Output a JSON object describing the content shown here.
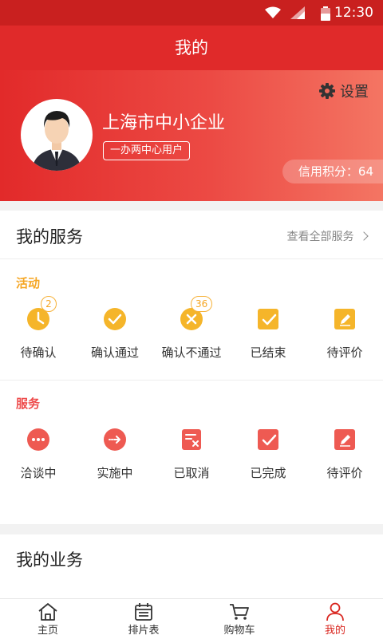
{
  "status_bar": {
    "time": "12:30"
  },
  "header": {
    "title": "我的"
  },
  "profile": {
    "company": "上海市中小企业",
    "user_tag": "一办两中心用户",
    "settings_label": "设置",
    "credit_label": "信用积分：64"
  },
  "my_services": {
    "title": "我的服务",
    "view_all": "查看全部服务",
    "activity": {
      "label": "活动",
      "items": [
        {
          "label": "待确认",
          "icon": "clock-icon",
          "badge": "2"
        },
        {
          "label": "确认通过",
          "icon": "check-circle-icon",
          "badge": ""
        },
        {
          "label": "确认不通过",
          "icon": "x-circle-icon",
          "badge": "36"
        },
        {
          "label": "已结束",
          "icon": "check-square-icon",
          "badge": ""
        },
        {
          "label": "待评价",
          "icon": "edit-icon",
          "badge": ""
        }
      ]
    },
    "service": {
      "label": "服务",
      "items": [
        {
          "label": "洽谈中",
          "icon": "chat-icon"
        },
        {
          "label": "实施中",
          "icon": "arrow-right-circle-icon"
        },
        {
          "label": "已取消",
          "icon": "cancel-doc-icon"
        },
        {
          "label": "已完成",
          "icon": "check-square-icon"
        },
        {
          "label": "待评价",
          "icon": "edit-icon"
        }
      ]
    }
  },
  "my_business": {
    "title": "我的业务"
  },
  "tabbar": {
    "items": [
      {
        "label": "主页",
        "icon": "home-icon"
      },
      {
        "label": "排片表",
        "icon": "calendar-icon"
      },
      {
        "label": "购物车",
        "icon": "cart-icon"
      },
      {
        "label": "我的",
        "icon": "user-icon"
      }
    ]
  },
  "colors": {
    "brand_red": "#e02a2a",
    "activity_orange": "#f5a623",
    "service_red": "#ee4b4b"
  }
}
